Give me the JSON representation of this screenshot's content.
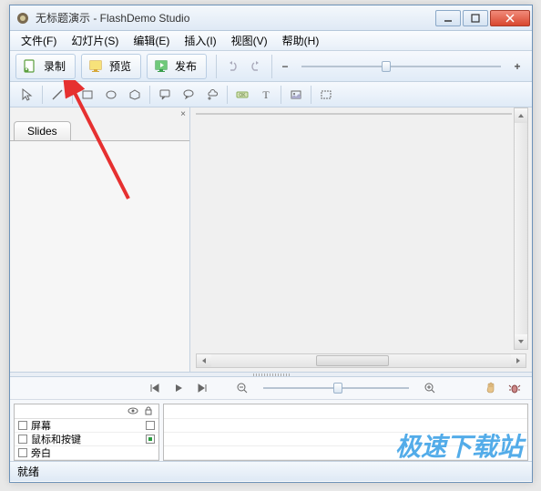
{
  "titlebar": {
    "title": "无标题演示 - FlashDemo Studio"
  },
  "menu": {
    "file": "文件(F)",
    "slide": "幻灯片(S)",
    "edit": "编辑(E)",
    "insert": "插入(I)",
    "view": "视图(V)",
    "help": "帮助(H)"
  },
  "toolbar": {
    "record": "录制",
    "preview": "预览",
    "publish": "发布",
    "minus": "−",
    "plus": "+"
  },
  "sidebar": {
    "close": "×",
    "tab": "Slides"
  },
  "timeline": {
    "tracks": {
      "screen": "屏幕",
      "mouse_keys": "鼠标和按键",
      "narration": "旁白"
    }
  },
  "status": {
    "ready": "就绪"
  },
  "watermark": "极速下载站",
  "shapetools": {
    "pointer": "pointer",
    "line": "line",
    "rect": "rect",
    "ellipse": "ellipse",
    "polygon": "polygon",
    "callout1": "callout1",
    "callout2": "callout2",
    "callout3": "callout3",
    "button": "button",
    "text": "text",
    "image": "image",
    "hotspot": "hotspot"
  }
}
